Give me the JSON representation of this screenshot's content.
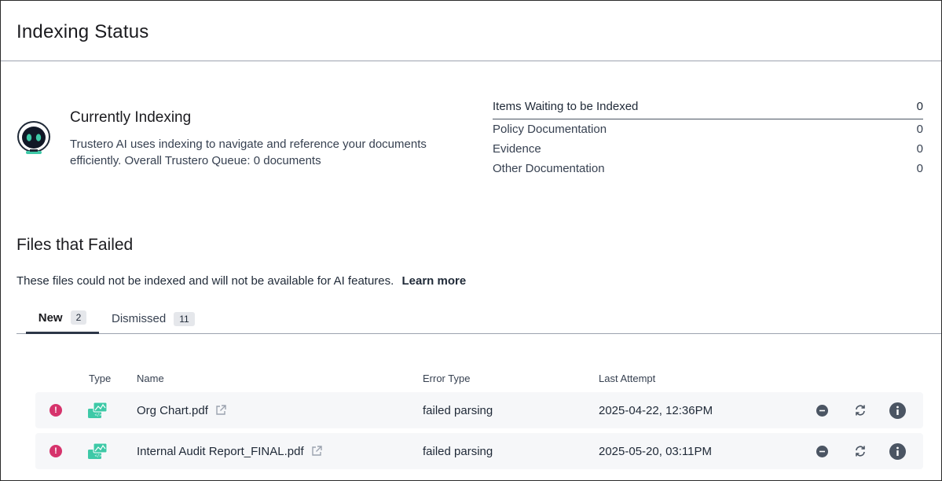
{
  "page": {
    "title": "Indexing Status"
  },
  "currently_indexing": {
    "heading": "Currently Indexing",
    "description": "Trustero AI uses indexing to navigate and reference your documents efficiently. Overall Trustero Queue: 0 documents",
    "icon": "robot-icon"
  },
  "queue": {
    "header": {
      "label": "Items Waiting to be Indexed",
      "value": "0"
    },
    "items": [
      {
        "label": "Policy Documentation",
        "value": "0"
      },
      {
        "label": "Evidence",
        "value": "0"
      },
      {
        "label": "Other Documentation",
        "value": "0"
      }
    ]
  },
  "failed": {
    "heading": "Files that Failed",
    "description": "These files could not be indexed and will not be available for AI features.",
    "learn_more": "Learn more"
  },
  "tabs": [
    {
      "label": "New",
      "count": "2",
      "active": true
    },
    {
      "label": "Dismissed",
      "count": "11",
      "active": false
    }
  ],
  "table": {
    "columns": {
      "type": "Type",
      "name": "Name",
      "error_type": "Error Type",
      "last_attempt": "Last Attempt"
    },
    "rows": [
      {
        "name": "Org Chart.pdf",
        "error_type": "failed parsing",
        "last_attempt": "2025-04-22, 12:36PM"
      },
      {
        "name": "Internal Audit Report_FINAL.pdf",
        "error_type": "failed parsing",
        "last_attempt": "2025-05-20, 03:11PM"
      }
    ]
  },
  "colors": {
    "error": "#d6336c",
    "file_icon": "#3ec9a7",
    "action_icon": "#4b5563",
    "row_background": "#f6f7f9"
  }
}
